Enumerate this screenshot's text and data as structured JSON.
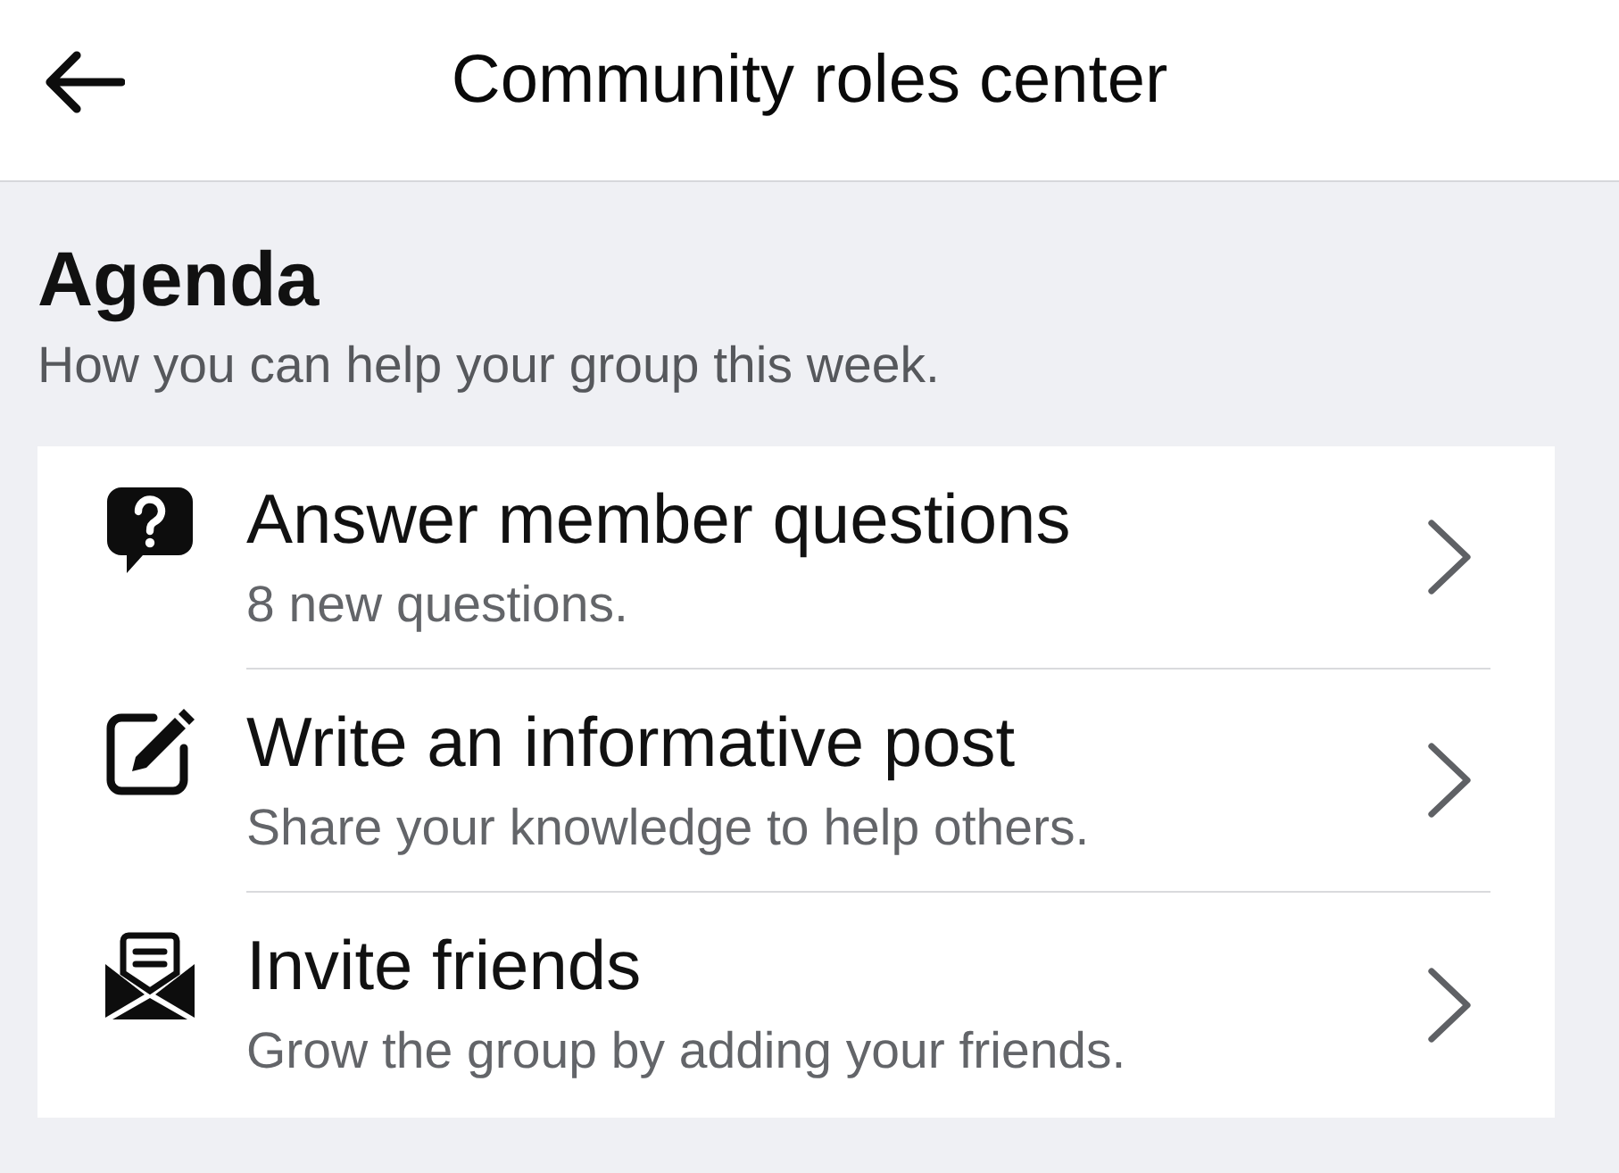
{
  "header": {
    "title": "Community roles center"
  },
  "agenda": {
    "heading": "Agenda",
    "subtitle": "How you can help your group this week."
  },
  "tasks": [
    {
      "kind": "question",
      "title": "Answer member questions",
      "subtitle": "8 new questions."
    },
    {
      "kind": "post",
      "title": "Write an informative post",
      "subtitle": "Share your knowledge to help others."
    },
    {
      "kind": "invite",
      "title": "Invite friends",
      "subtitle": "Grow the group by adding your friends."
    }
  ]
}
